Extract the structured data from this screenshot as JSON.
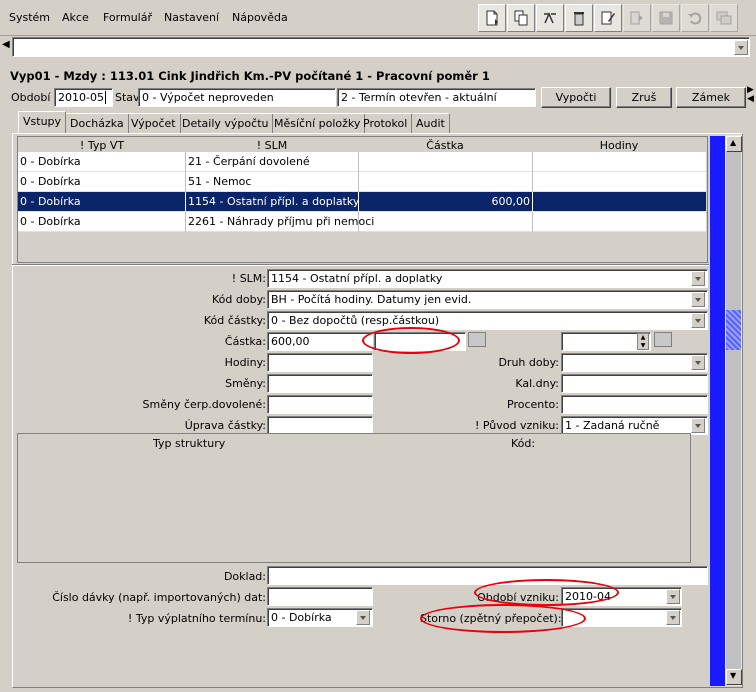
{
  "menu": {
    "items": [
      "Systém",
      "Akce",
      "Formulář",
      "Nastavení",
      "Nápověda"
    ]
  },
  "toolbar": {
    "icons": [
      "new-record-icon",
      "copy-record-icon",
      "edit-link-icon",
      "delete-icon",
      "edit-note-icon",
      "forward-icon",
      "save-icon",
      "undo-icon",
      "cascade-windows-icon"
    ]
  },
  "header": {
    "title": "Vyp01 - Mzdy : 113.01 Cink Jindřich Km.-PV počítané 1 - Pracovní poměr 1",
    "period_label": "Období",
    "period_value": "2010-05",
    "status_label": "Stav",
    "status_value": "0 - Výpočet neproveden",
    "term_value": "2 - Termín otevřen - aktuální",
    "btn_calc": "Vypočti",
    "btn_cancel": "Zruš",
    "btn_lock": "Zámek"
  },
  "tabs": [
    "Vstupy",
    "Docházka",
    "Výpočet",
    "Detaily výpočtu",
    "Měsíční položky",
    "Protokol",
    "Audit"
  ],
  "grid": {
    "columns": [
      "! Typ VT",
      "! SLM",
      "Částka",
      "Hodiny"
    ],
    "rows": [
      [
        "0 - Dobírka",
        "21 - Čerpání dovolené",
        "",
        ""
      ],
      [
        "0 - Dobírka",
        "51 - Nemoc",
        "",
        ""
      ],
      [
        "0 - Dobírka",
        "1154 - Ostatní přípl. a doplatky",
        "600,00",
        ""
      ],
      [
        "0 - Dobírka",
        "2261 - Náhrady příjmu při nemoci",
        "",
        ""
      ]
    ],
    "selected_row": 2
  },
  "form": {
    "slm_label": "! SLM:",
    "slm_value": "1154 - Ostatní přípl. a doplatky",
    "kod_doby_label": "Kód doby:",
    "kod_doby_value": "BH - Počítá hodiny. Datumy jen evid.",
    "kod_castky_label": "Kód částky:",
    "kod_castky_value": "0 - Bez dopočtů (resp.částkou)",
    "castka_label": "Částka:",
    "castka_value": "600,00",
    "hodiny_label": "Hodiny:",
    "smeny_label": "Směny:",
    "smeny_cerp_label": "Směny čerp.dovolené:",
    "uprava_label": "Úprava částky:",
    "druh_doby_label": "Druh doby:",
    "kal_dny_label": "Kal.dny:",
    "procento_label": "Procento:",
    "puvod_label": "! Původ vzniku:",
    "puvod_value": "1 - Zadaná ručně",
    "typ_struktury_label": "Typ struktury",
    "kod_label": "Kód:",
    "doklad_label": "Doklad:",
    "cislo_davky_label": "Číslo dávky (např. importovaných) dat:",
    "obdobi_vzniku_label": "Období vzniku:",
    "obdobi_vzniku_value": "2010-04",
    "typ_vypl_label": "! Typ výplatního termínu:",
    "typ_vypl_value": "0 - Dobírka",
    "storno_label": "Storno (zpětný přepočet):"
  },
  "colors": {
    "selection": "#0a246a",
    "annotation": "#e8000a",
    "scrollbar": "#1a1aff"
  }
}
